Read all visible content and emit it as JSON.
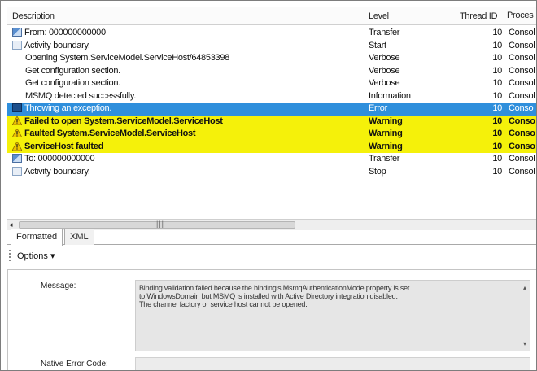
{
  "columns": {
    "description": "Description",
    "level": "Level",
    "thread_id": "Thread ID",
    "process": "Proces"
  },
  "rows": [
    {
      "icon": "transfer-icon",
      "description": "From: 000000000000",
      "level": "Transfer",
      "thread_id": "10",
      "process": "Consol",
      "style": "normal",
      "indent": false
    },
    {
      "icon": "activity-icon",
      "description": "Activity boundary.",
      "level": "Start",
      "thread_id": "10",
      "process": "Consol",
      "style": "normal",
      "indent": false
    },
    {
      "icon": "",
      "description": "Opening System.ServiceModel.ServiceHost/64853398",
      "level": "Verbose",
      "thread_id": "10",
      "process": "Consol",
      "style": "normal",
      "indent": true
    },
    {
      "icon": "",
      "description": "Get configuration section.",
      "level": "Verbose",
      "thread_id": "10",
      "process": "Consol",
      "style": "normal",
      "indent": true
    },
    {
      "icon": "",
      "description": "Get configuration section.",
      "level": "Verbose",
      "thread_id": "10",
      "process": "Consol",
      "style": "normal",
      "indent": true
    },
    {
      "icon": "",
      "description": "MSMQ detected successfully.",
      "level": "Information",
      "thread_id": "10",
      "process": "Consol",
      "style": "normal",
      "indent": true
    },
    {
      "icon": "error-icon",
      "description": "Throwing an exception.",
      "level": "Error",
      "thread_id": "10",
      "process": "Conso",
      "style": "error",
      "indent": false
    },
    {
      "icon": "warning-icon",
      "description": "Failed to open System.ServiceModel.ServiceHost",
      "level": "Warning",
      "thread_id": "10",
      "process": "Conso",
      "style": "warning",
      "indent": false
    },
    {
      "icon": "warning-icon",
      "description": "Faulted System.ServiceModel.ServiceHost",
      "level": "Warning",
      "thread_id": "10",
      "process": "Conso",
      "style": "warning",
      "indent": false
    },
    {
      "icon": "warning-icon",
      "description": "ServiceHost faulted",
      "level": "Warning",
      "thread_id": "10",
      "process": "Conso",
      "style": "warning",
      "indent": false
    },
    {
      "icon": "transfer-icon",
      "description": "To: 000000000000",
      "level": "Transfer",
      "thread_id": "10",
      "process": "Consol",
      "style": "normal",
      "indent": false
    },
    {
      "icon": "activity-icon",
      "description": "Activity boundary.",
      "level": "Stop",
      "thread_id": "10",
      "process": "Consol",
      "style": "normal",
      "indent": false
    }
  ],
  "tabs": [
    {
      "label": "Formatted",
      "active": true
    },
    {
      "label": "XML",
      "active": false
    }
  ],
  "options_label": "Options ▾",
  "detail": {
    "message_label": "Message:",
    "message_text": "Binding validation failed because the binding's MsmqAuthenticationMode property is set\nto WindowsDomain but MSMQ is installed with Active Directory integration disabled.\nThe channel factory or service host cannot be opened.",
    "native_error_label": "Native Error Code:",
    "native_error_value": ""
  },
  "colors": {
    "error_row": "#2f8fdc",
    "warning_row": "#f5f10a"
  }
}
